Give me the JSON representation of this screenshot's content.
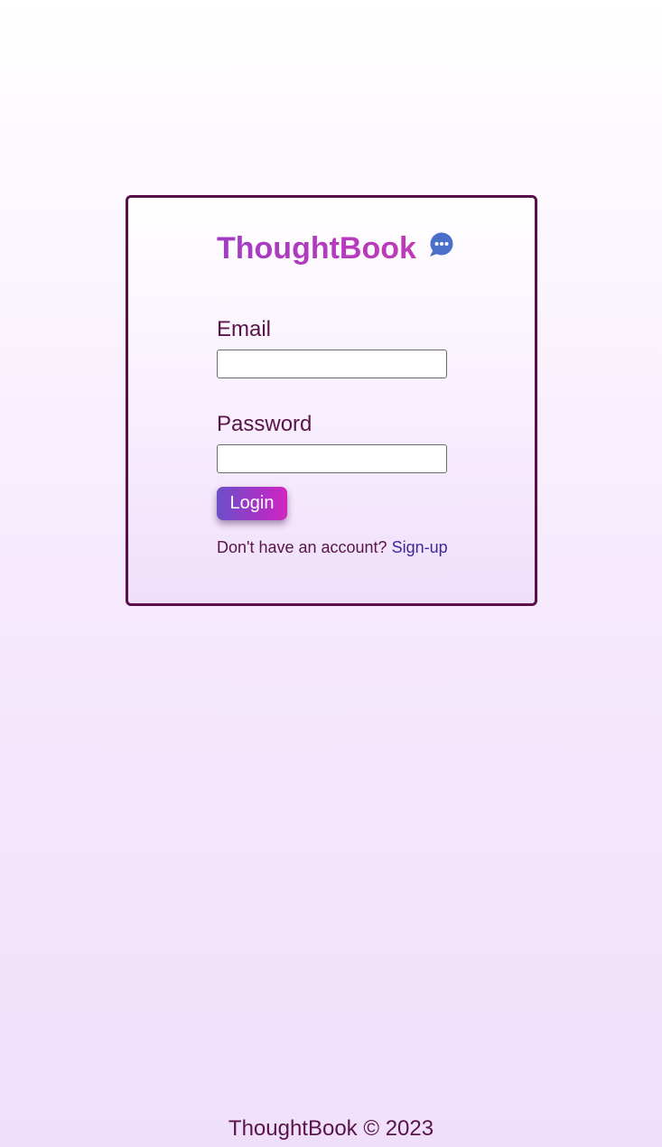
{
  "app": {
    "title": "ThoughtBook",
    "accent_color": "#b03cbf",
    "icon": "chat-bubble-icon"
  },
  "login_form": {
    "email_label": "Email",
    "email_value": "",
    "password_label": "Password",
    "password_value": "",
    "login_label": "Login",
    "signup_prompt": "Don't have an account?",
    "signup_link": "Sign-up"
  },
  "footer": {
    "text": "ThoughtBook © 2023"
  }
}
